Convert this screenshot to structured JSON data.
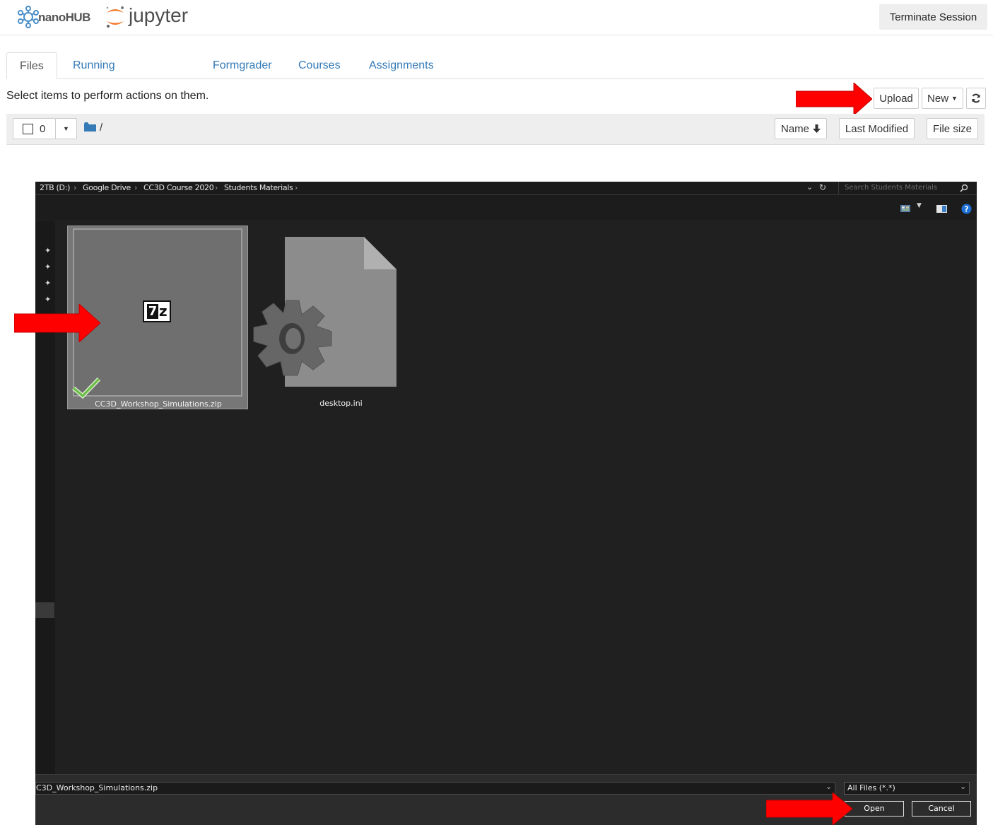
{
  "header": {
    "nanohub_label": "nanoHUB",
    "jupyter_label": "jupyter",
    "terminate_label": "Terminate Session"
  },
  "tabs": [
    {
      "label": "Files",
      "active": true
    },
    {
      "label": "Running",
      "active": false
    },
    {
      "label": "Formgrader",
      "active": false
    },
    {
      "label": "Courses",
      "active": false
    },
    {
      "label": "Assignments",
      "active": false
    }
  ],
  "files_panel": {
    "hint": "Select items to perform actions on them.",
    "upload_label": "Upload",
    "new_label": "New",
    "select_count": "0",
    "path": "/",
    "sort_columns": [
      "Name",
      "Last Modified",
      "File size"
    ]
  },
  "dialog": {
    "breadcrumb": [
      "2TB (D:)",
      "Google Drive",
      "CC3D Course 2020",
      "Students Materials"
    ],
    "search_placeholder": "Search Students Materials",
    "files": [
      {
        "name": "CC3D_Workshop_Simulations.zip",
        "icon": "7z-archive-icon",
        "selected": true
      },
      {
        "name": "desktop.ini",
        "icon": "settings-file-icon",
        "selected": false
      }
    ],
    "filename_value": "C3D_Workshop_Simulations.zip",
    "filetype_value": "All Files (*.*)",
    "open_label": "Open",
    "cancel_label": "Cancel",
    "sevenz_glyph_a": "7",
    "sevenz_glyph_b": "z"
  },
  "colors": {
    "link": "#337ab7",
    "arrow_red": "#ff0000",
    "dialog_bg": "#202020",
    "check_green": "#6fbf4a"
  }
}
